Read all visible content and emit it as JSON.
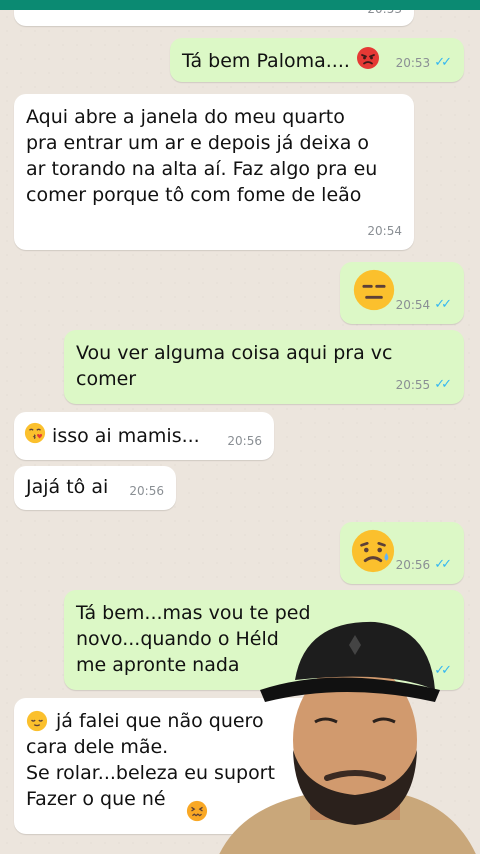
{
  "messages": [
    {
      "direction": "in",
      "text": "",
      "time": "20:53"
    },
    {
      "direction": "out",
      "text": "Tá bem Paloma....",
      "emoji": "angry-face",
      "time": "20:53",
      "read": true
    },
    {
      "direction": "in",
      "text": "Aqui abre a janela do meu quarto\npra entrar um ar e depois já deixa o\nar torando na alta aí. Faz algo pra eu\ncomer porque tô com fome de leão",
      "time": "20:54"
    },
    {
      "direction": "out",
      "text": "",
      "emoji": "expressionless-face",
      "time": "20:54",
      "read": true
    },
    {
      "direction": "out",
      "text": "Vou ver alguma coisa aqui pra vc\ncomer",
      "time": "20:55",
      "read": true
    },
    {
      "direction": "in",
      "text": "isso ai mamis...",
      "emoji": "kissing-face",
      "time": "20:56"
    },
    {
      "direction": "in",
      "text": "Jajá tô ai",
      "time": "20:56"
    },
    {
      "direction": "out",
      "text": "",
      "emoji": "sad-sweat-face",
      "time": "20:56",
      "read": true
    },
    {
      "direction": "out",
      "text": "Tá bem...mas vou te ped\nnovo...quando o Héld\nme apronte nada",
      "time": "",
      "read": true
    },
    {
      "direction": "in",
      "text": "já falei que não quero\ncara dele mãe.\nSe rolar...beleza eu suport\nFazer o que né",
      "emoji": "relieved-face",
      "emoji2": "confounded-face",
      "time": ""
    }
  ],
  "colors": {
    "incoming": "#ffffff",
    "outgoing": "#dcf8c6",
    "accent": "#0b8a72",
    "ticks": "#34b7f1"
  }
}
